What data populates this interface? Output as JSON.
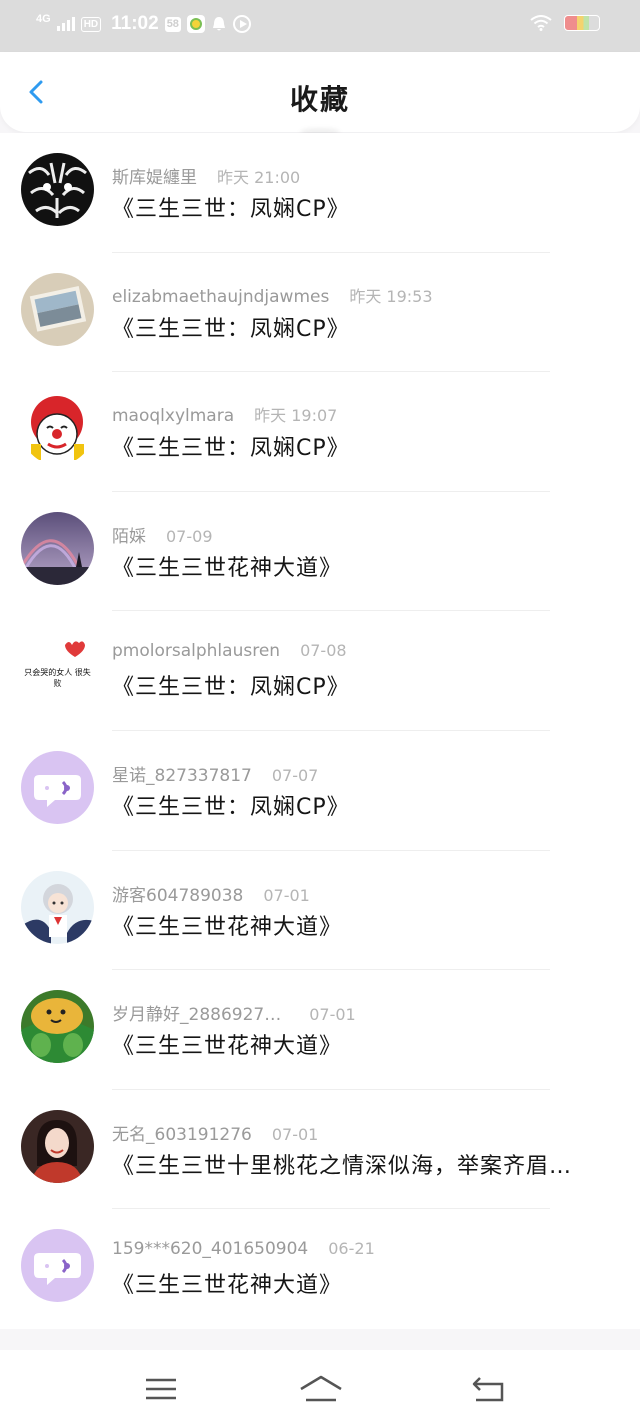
{
  "status_bar": {
    "network": "4G",
    "hd_label": "HD",
    "time": "11:02",
    "badge": "58"
  },
  "header": {
    "title": "收藏",
    "back_icon": "chevron-left-icon"
  },
  "colors": {
    "accent": "#2f9bf0",
    "status_bar_bg": "#dcdcdc",
    "avatar_default_bg": "#d9c4f2"
  },
  "favorites": [
    {
      "user": "斯库媞纏里",
      "time": "昨天 21:00",
      "title": "《三生三世：凤娴CP》",
      "avatar": "tiger-avatar"
    },
    {
      "user": "elizabmaethaujndjawmes",
      "time": "昨天 19:53",
      "title": "《三生三世：凤娴CP》",
      "avatar": "photo-avatar"
    },
    {
      "user": "maoqlxylmara",
      "time": "昨天 19:07",
      "title": "《三生三世：凤娴CP》",
      "avatar": "clown-avatar"
    },
    {
      "user": "陌婇",
      "time": "07-09",
      "title": "《三生三世花神大道》",
      "avatar": "rainbow-avatar"
    },
    {
      "user": "pmolorsalphlausren",
      "time": "07-08",
      "title": "《三生三世：凤娴CP》",
      "avatar": "heart-text-avatar",
      "avatar_text": "只会哭的女人 很失败"
    },
    {
      "user": "星诺_827337817",
      "time": "07-07",
      "title": "《三生三世：凤娴CP》",
      "avatar": "default-chat-avatar"
    },
    {
      "user": "游客604789038",
      "time": "07-01",
      "title": "《三生三世花神大道》",
      "avatar": "anime-avatar"
    },
    {
      "user": "岁月静好_2886927…",
      "time": "07-01",
      "title": "《三生三世花神大道》",
      "avatar": "food-avatar"
    },
    {
      "user": "无名_603191276",
      "time": "07-01",
      "title": "《三生三世十里桃花之情深似海，举案齐眉…",
      "avatar": "portrait-avatar"
    },
    {
      "user": "159***620_401650904",
      "time": "06-21",
      "title": "《三生三世花神大道》",
      "avatar": "default-chat-avatar"
    }
  ],
  "nav_bar": {
    "menu_icon": "menu-icon",
    "home_icon": "home-icon",
    "back_icon": "back-icon"
  }
}
